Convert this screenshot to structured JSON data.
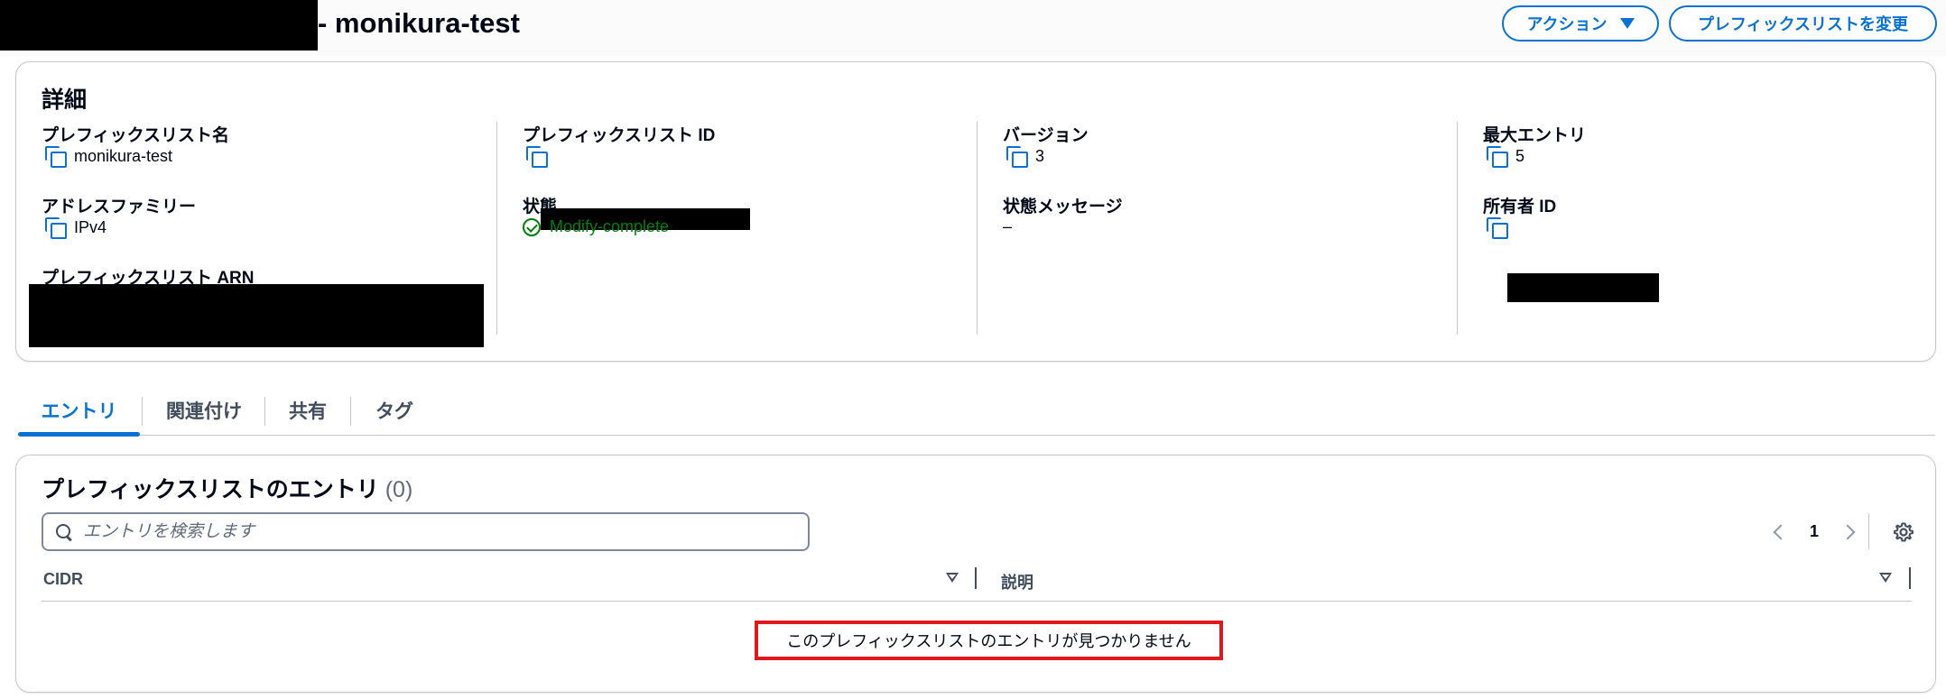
{
  "header": {
    "title": "- monikura-test",
    "actions_label": "アクション",
    "modify_label": "プレフィックスリストを変更"
  },
  "details": {
    "heading": "詳細",
    "prefix_list_name": {
      "label": "プレフィックスリスト名",
      "value": "monikura-test"
    },
    "address_family": {
      "label": "アドレスファミリー",
      "value": "IPv4"
    },
    "prefix_list_arn": {
      "label": "プレフィックスリスト ARN"
    },
    "prefix_list_id": {
      "label": "プレフィックスリスト ID"
    },
    "state": {
      "label": "状態",
      "value": "Modify-complete",
      "color": "#037f0c"
    },
    "version": {
      "label": "バージョン",
      "value": "3"
    },
    "state_message": {
      "label": "状態メッセージ",
      "value": "–"
    },
    "max_entries": {
      "label": "最大エントリ",
      "value": "5"
    },
    "owner_id": {
      "label": "所有者 ID"
    }
  },
  "tabs": [
    {
      "label": "エントリ",
      "active": true
    },
    {
      "label": "関連付け"
    },
    {
      "label": "共有"
    },
    {
      "label": "タグ"
    }
  ],
  "entries": {
    "heading": "プレフィックスリストのエントリ",
    "count": "(0)",
    "search_placeholder": "エントリを検索します",
    "page": "1",
    "columns": [
      "CIDR",
      "説明"
    ],
    "empty_message": "このプレフィックスリストのエントリが見つかりません"
  },
  "colors": {
    "accent": "#0972d3",
    "success": "#037f0c",
    "highlight_border": "#e0191e"
  },
  "icons": [
    "copy-icon",
    "check-circle-icon",
    "search-icon",
    "chevron-left-icon",
    "chevron-right-icon",
    "gear-icon",
    "sort-icon",
    "caret-down-icon"
  ]
}
